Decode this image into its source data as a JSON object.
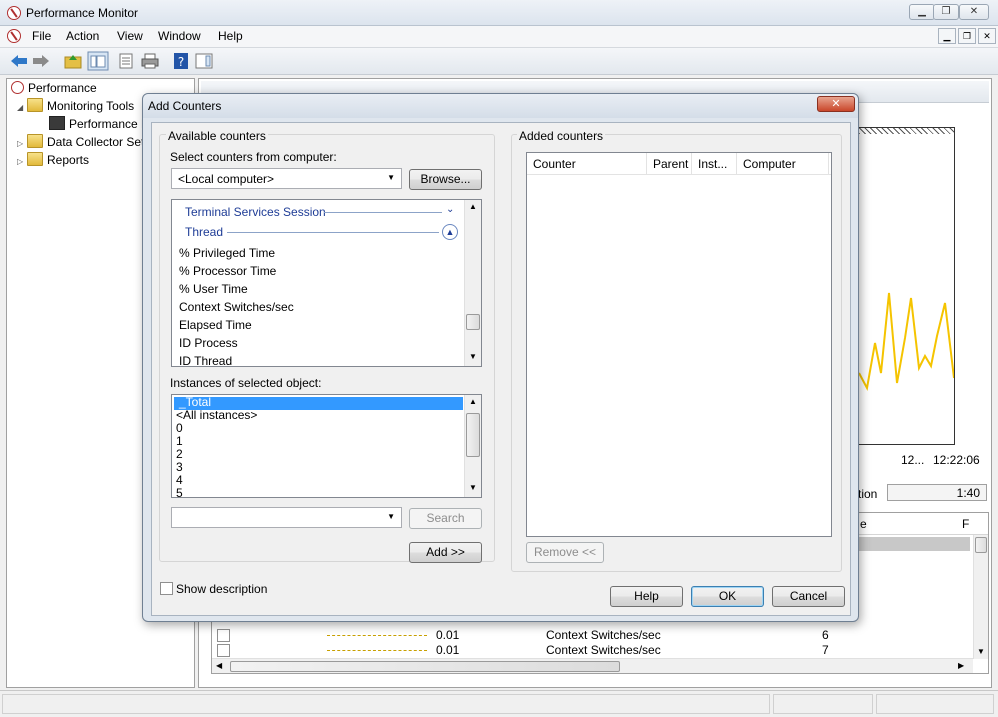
{
  "window": {
    "title": "Performance Monitor",
    "caption_buttons": [
      "minimize-icon",
      "restore-icon",
      "close-icon"
    ]
  },
  "menubar": {
    "items": [
      "File",
      "Action",
      "View",
      "Window",
      "Help"
    ]
  },
  "tree": {
    "root": "Performance",
    "monitoring_tools": "Monitoring Tools",
    "performance_monitor": "Performance Monitor",
    "data_collector_sets": "Data Collector Sets",
    "reports": "Reports"
  },
  "background": {
    "graph_times": [
      "12...",
      "12:22:06"
    ],
    "duration_label": "tion",
    "duration_value": "1:40",
    "column_header": "e",
    "rows": [
      {
        "value": "0.01",
        "counter": "Context Switches/sec",
        "instance": "6"
      },
      {
        "value": "0.01",
        "counter": "Context Switches/sec",
        "instance": "7"
      }
    ],
    "graph_color": "#f5c400"
  },
  "dialog": {
    "title": "Add Counters",
    "available_counters_label": "Available counters",
    "select_from_computer_label": "Select counters from computer:",
    "computer_value": "<Local computer>",
    "browse_button": "Browse...",
    "counter_categories": [
      {
        "label": "Terminal Services Session",
        "state": "collapsed"
      },
      {
        "label": "Thread",
        "state": "expanded"
      }
    ],
    "counters": [
      "% Privileged Time",
      "% Processor Time",
      "% User Time",
      "Context Switches/sec",
      "Elapsed Time",
      "ID Process",
      "ID Thread"
    ],
    "instances_label": "Instances of selected object:",
    "instances": [
      "_Total",
      "<All instances>",
      "0",
      "1",
      "2",
      "3",
      "4",
      "5"
    ],
    "selected_instance": "_Total",
    "search_value": "",
    "search_button": "Search",
    "add_button": "Add >>",
    "added_counters_label": "Added counters",
    "added_columns": [
      "Counter",
      "Parent",
      "Inst...",
      "Computer"
    ],
    "remove_button": "Remove <<",
    "show_description_label": "Show description",
    "show_description_checked": false,
    "help_button": "Help",
    "ok_button": "OK",
    "cancel_button": "Cancel"
  }
}
